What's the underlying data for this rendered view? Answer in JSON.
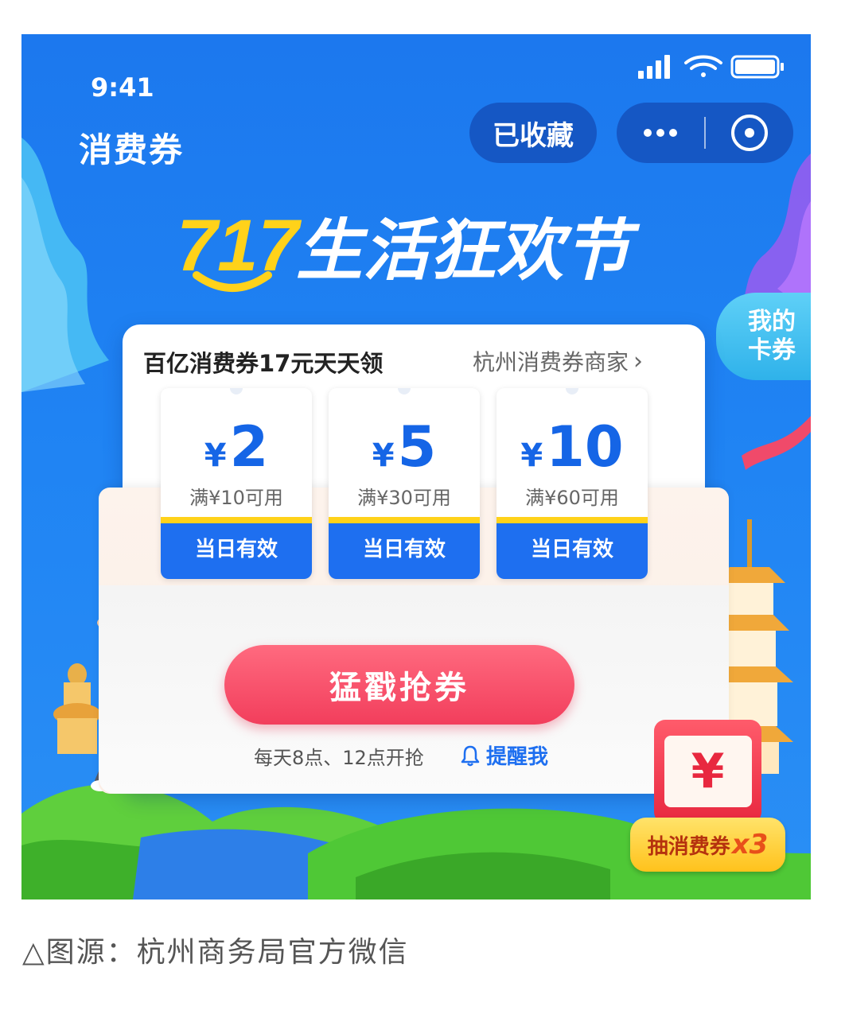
{
  "status_bar": {
    "time": "9:41"
  },
  "header": {
    "title": "消费券",
    "favorite_label": "已收藏",
    "more_label": "···"
  },
  "banner": {
    "number": "717",
    "title": "生活狂欢节"
  },
  "side_tab": {
    "line1": "我的",
    "line2": "卡券"
  },
  "coupon_card": {
    "title": "百亿消费券17元天天领",
    "merchant_link": "杭州消费券商家",
    "coupons": [
      {
        "currency": "¥",
        "amount": "2",
        "condition": "满¥10可用",
        "validity": "当日有效"
      },
      {
        "currency": "¥",
        "amount": "5",
        "condition": "满¥30可用",
        "validity": "当日有效"
      },
      {
        "currency": "¥",
        "amount": "10",
        "condition": "满¥60可用",
        "validity": "当日有效"
      }
    ],
    "grab_button": "猛戳抢券",
    "schedule": "每天8点、12点开抢",
    "remind_button": "提醒我"
  },
  "lottery": {
    "label": "抽消费券",
    "multiplier": "x3",
    "envelope_symbol": "¥"
  },
  "caption": "△图源：杭州商务局官方微信",
  "colors": {
    "primary_blue": "#1e6ff0",
    "accent_red": "#f23e5c",
    "yellow": "#ffd21a"
  }
}
